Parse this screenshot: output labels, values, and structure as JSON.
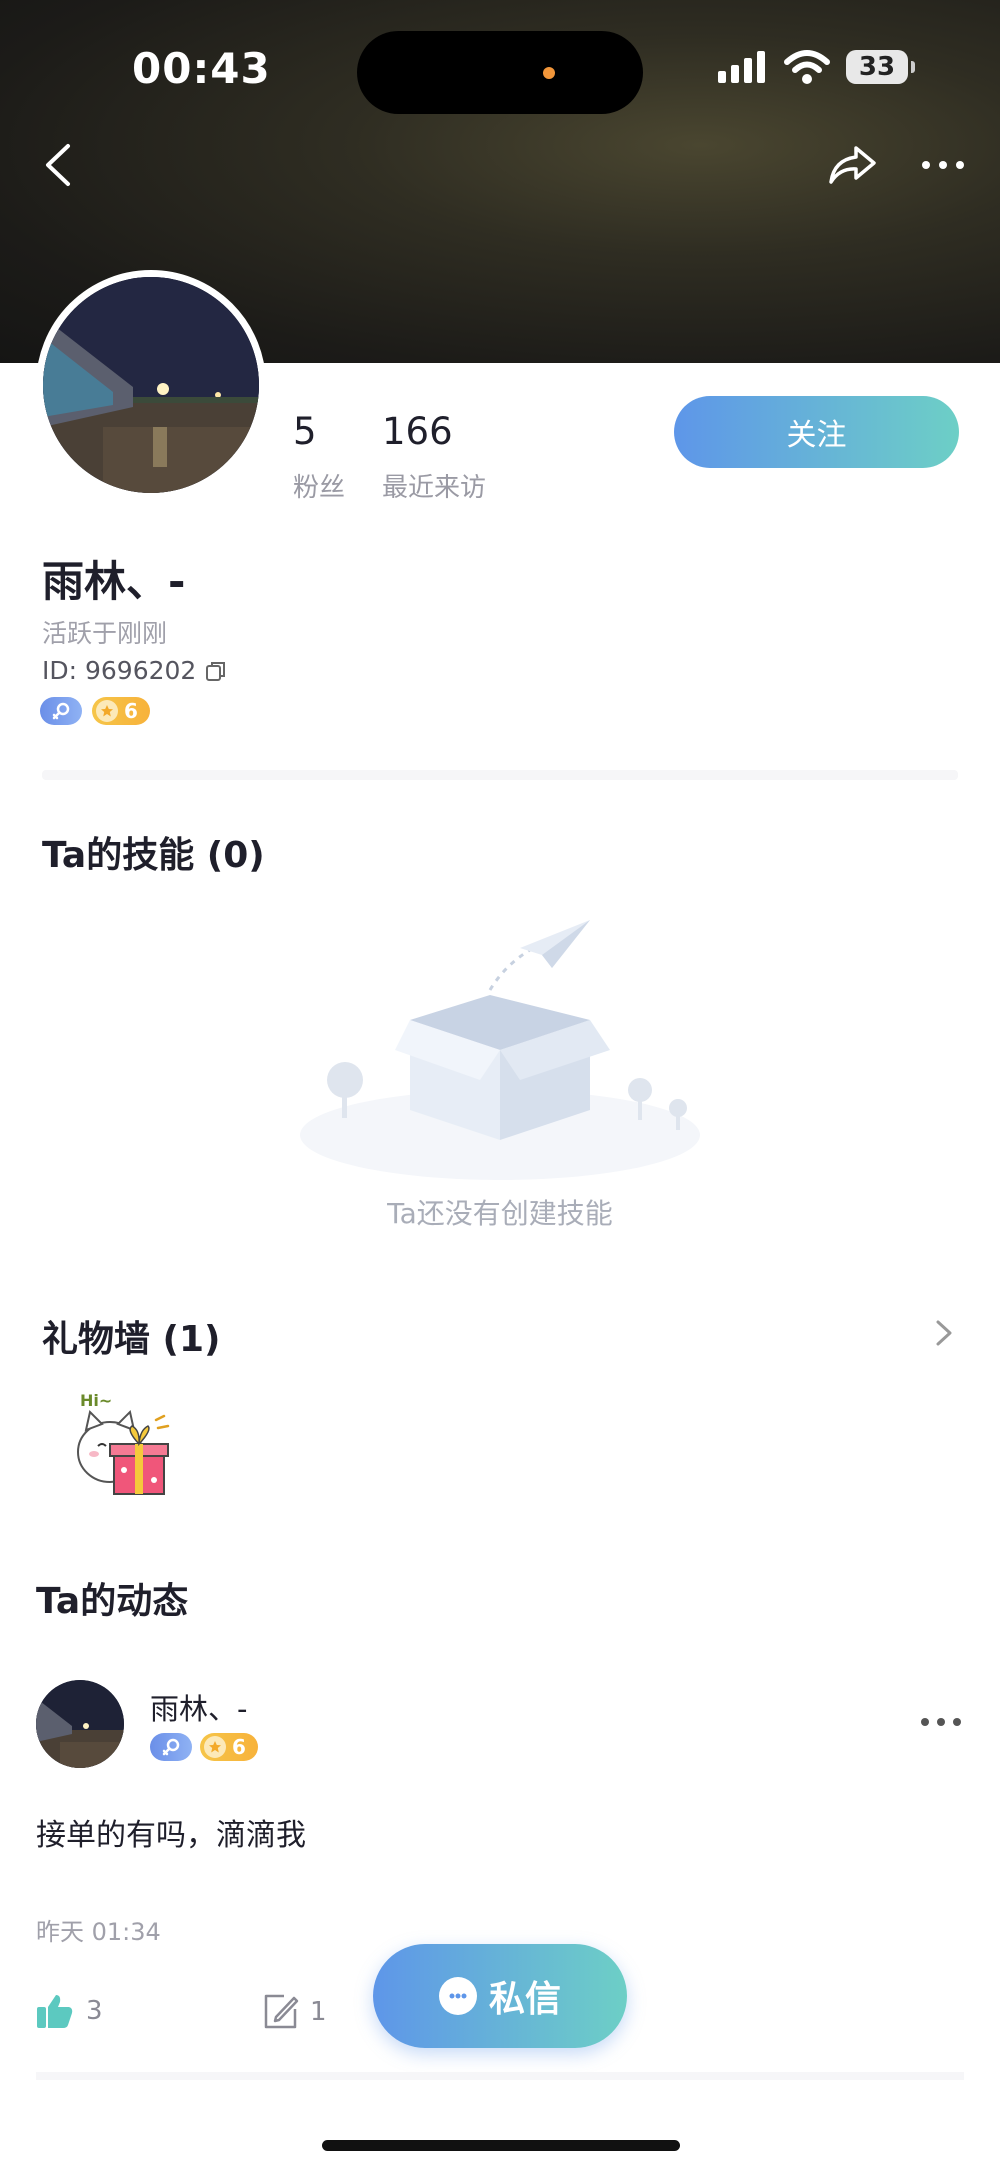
{
  "status_bar": {
    "time": "00:43",
    "battery": "33"
  },
  "header": {
    "back_icon": "chevron-left-icon",
    "share_icon": "share-icon",
    "more_icon": "more-icon"
  },
  "profile": {
    "followers_count": "5",
    "followers_label": "粉丝",
    "visitors_count": "166",
    "visitors_label": "最近来访",
    "follow_label": "关注",
    "name": "雨林、-",
    "active_status": "活跃于刚刚",
    "id_text": "ID: 9696202",
    "level": "6"
  },
  "skills": {
    "title": "Ta的技能 (0)",
    "empty_text": "Ta还没有创建技能"
  },
  "gift_wall": {
    "title": "礼物墙 (1)",
    "gift_caption": "Hi~"
  },
  "feed": {
    "title": "Ta的动态",
    "post": {
      "author": "雨林、-",
      "level": "6",
      "text": "接单的有吗，滴滴我",
      "time": "昨天 01:34",
      "likes": "3",
      "comments": "1"
    }
  },
  "actions": {
    "message_label": "私信"
  },
  "colors": {
    "accent_start": "#5e96e9",
    "accent_end": "#6dcfc6",
    "level_badge": "#f6c548"
  }
}
